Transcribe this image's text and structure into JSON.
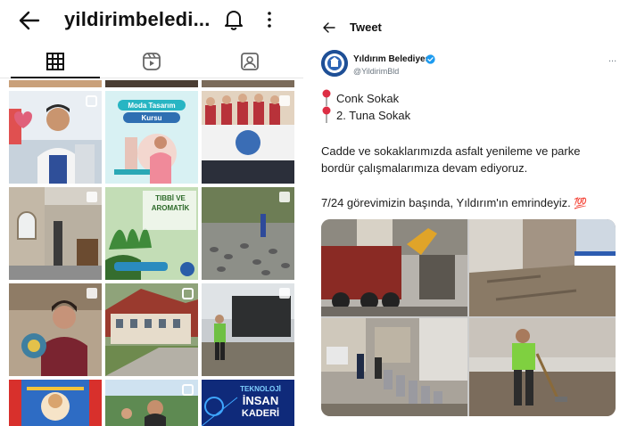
{
  "instagram": {
    "title": "yildirimbeledi...",
    "icons": [
      "back-arrow-icon",
      "bell-icon",
      "more-vertical-icon",
      "grid-icon",
      "reels-icon",
      "tagged-icon"
    ],
    "tiles": [
      {
        "label": "Moda Tasarım",
        "sublabel": "Kursu"
      },
      {
        "label": "TIBBİ VE",
        "sublabel": "AROMATİK"
      },
      {
        "label": "TEKNOLOJİ",
        "sublabel": "İNSAN",
        "extra": "KADERİ"
      }
    ]
  },
  "tweet": {
    "header_title": "Tweet",
    "author_name": "Yıldırım Belediyesi",
    "author_handle": "@YildirimBld",
    "more": "...",
    "pin_line_1": "Conk Sokak",
    "pin_line_2": "2. Tuna Sokak",
    "body_line_1": "Cadde ve sokaklarımızda asfalt yenileme ve parke",
    "body_line_2": "bordür çalışmalarımıza devam ediyoruz.",
    "body_line_3": "7/24 görevimizin başında, Yıldırım'ın emrindeyiz.",
    "emoji_100": "💯",
    "accent_color": "#1d9bf0",
    "pin_color": "#dd2e44"
  }
}
